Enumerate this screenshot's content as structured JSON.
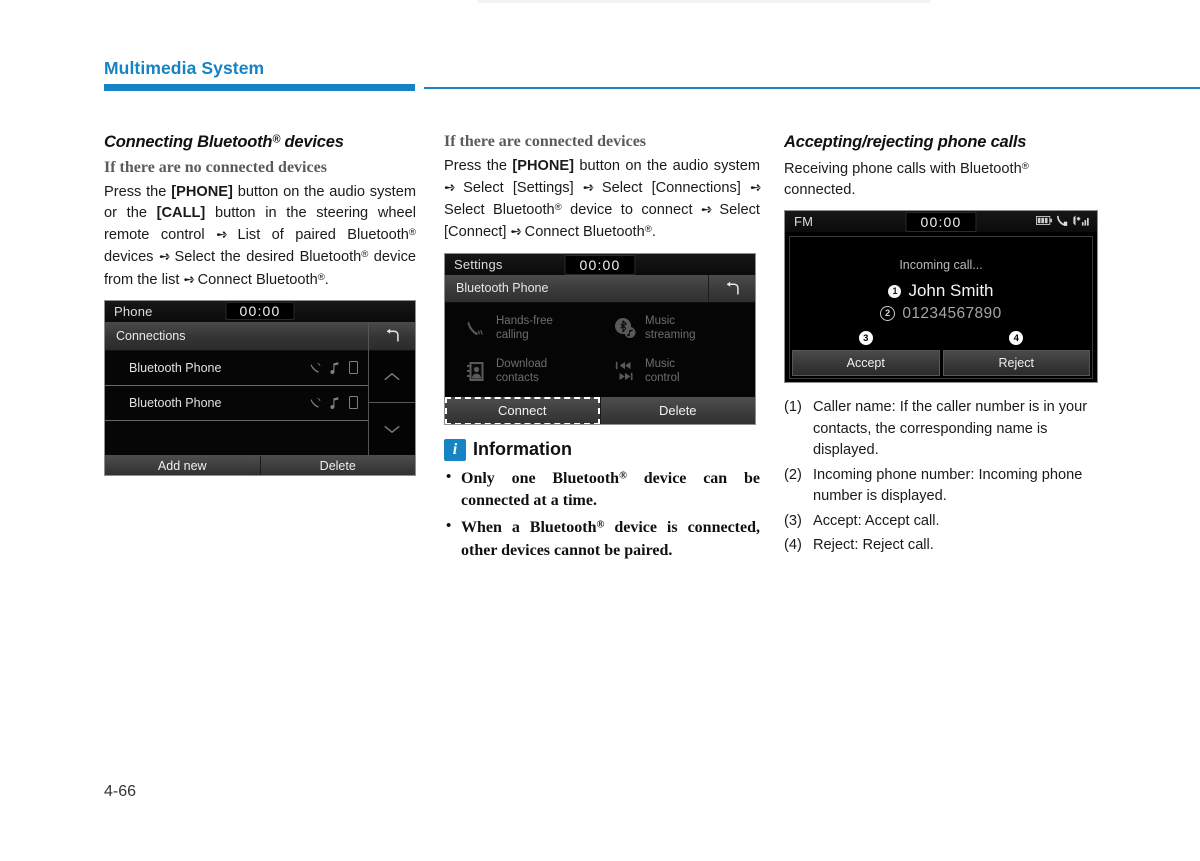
{
  "header": {
    "title": "Multimedia System",
    "accent_color": "#1583c4"
  },
  "footer": {
    "page_number": "4-66"
  },
  "col1": {
    "section_title_pre": "Connecting Bluetooth",
    "section_title_post": " devices",
    "sub_title": "If there are no connected devices",
    "para_1": "Press the ",
    "para_bold_1": "[PHONE]",
    "para_2": " button on the audio system or the ",
    "para_bold_2": "[CALL]",
    "para_3": " button in the steering wheel remote control ",
    "para_4": " List of paired Bluetooth",
    "para_5": " devices ",
    "para_6": " Select the desired Bluetooth",
    "para_7": " device from the list ",
    "para_8": " Connect Bluetooth",
    "para_9": ".",
    "device": {
      "source": "Phone",
      "clock": "00:00",
      "subheader": "Connections",
      "back_icon": "back-arrow-icon",
      "rows": [
        {
          "name": "Bluetooth Phone"
        },
        {
          "name": "Bluetooth Phone"
        },
        {
          "name": ""
        }
      ],
      "scroll_up_icon": "chevron-up-icon",
      "scroll_down_icon": "chevron-down-icon",
      "footer_buttons": [
        "Add new",
        "Delete"
      ]
    }
  },
  "col2": {
    "sub_title": "If there are connected devices",
    "para_1": "Press the ",
    "para_bold_1": "[PHONE]",
    "para_2": " button on the audio system ",
    "para_3": " Select [Settings] ",
    "para_4": " Select [Connections] ",
    "para_5": " Select Bluetooth",
    "para_6": " device to connect ",
    "para_7": " Select [Connect] ",
    "para_8": " Connect Bluetooth",
    "para_9": ".",
    "device": {
      "source": "Settings",
      "clock": "00:00",
      "subheader": "Bluetooth Phone",
      "back_icon": "back-arrow-icon",
      "features": [
        {
          "label_line1": "Hands-free",
          "label_line2": "calling",
          "icon": "handset-waves-icon"
        },
        {
          "label_line1": "Music",
          "label_line2": "streaming",
          "icon": "bluetooth-music-icon"
        },
        {
          "label_line1": "Download",
          "label_line2": "contacts",
          "icon": "contacts-book-icon"
        },
        {
          "label_line1": "Music",
          "label_line2": "control",
          "icon": "track-skip-icon"
        }
      ],
      "footer_buttons": [
        "Connect",
        "Delete"
      ],
      "selected_footer_button": "Connect"
    },
    "information": {
      "icon_letter": "i",
      "title": "Information",
      "bullets": [
        {
          "pre": "Only one Bluetooth",
          "post": " device can be connected at a time."
        },
        {
          "pre": "When a Bluetooth",
          "post": " device is connected, other devices cannot be paired."
        }
      ]
    }
  },
  "col3": {
    "section_title": "Accepting/rejecting phone calls",
    "para_pre": "Receiving phone calls with Bluetooth",
    "para_post": " connected.",
    "device": {
      "source": "FM",
      "clock": "00:00",
      "status_icons": [
        "battery-icon",
        "phone-bluetooth-icon",
        "signal-bars-icon"
      ],
      "call_status": "Incoming call...",
      "caller_name": "John Smith",
      "caller_number": "01234567890",
      "marker_name": "1",
      "marker_number": "2",
      "accept_label": "Accept",
      "accept_marker": "3",
      "reject_label": "Reject",
      "reject_marker": "4"
    },
    "legend": [
      {
        "num": "(1)",
        "text": "Caller name: If the caller number is in your contacts, the corresponding name is displayed."
      },
      {
        "num": "(2)",
        "text": "Incoming phone number: Incoming phone number is displayed."
      },
      {
        "num": "(3)",
        "text": "Accept: Accept call."
      },
      {
        "num": "(4)",
        "text": "Reject: Reject call."
      }
    ]
  }
}
